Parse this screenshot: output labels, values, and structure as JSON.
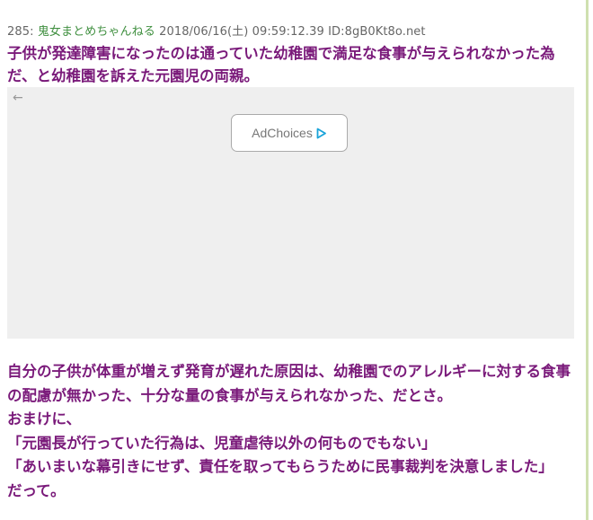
{
  "post": {
    "number": "285:",
    "name": "鬼女まとめちゃんねる",
    "datetime": "2018/06/16(土) 09:59:12.39",
    "id": "ID:8gB0Kt8o.net",
    "title": "子供が発達障害になったのは通っていた幼稚園で満足な食事が与えられなかった為だ、と幼稚園を訴えた元園児の両親。"
  },
  "ad": {
    "back_glyph": "←",
    "adchoices_label": "AdChoices",
    "adchoices_icon": "adchoices-triangle-icon",
    "accent_color": "#1aa3d9"
  },
  "body_lines": [
    "自分の子供が体重が増えず発育が遅れた原因は、幼稚園でのアレルギーに対する食事の配慮が無かった、十分な量の食事が与えられなかった、だとさ。",
    "おまけに、",
    "「元園長が行っていた行為は、児童虐待以外の何ものでもない」",
    "「あいまいな幕引きにせず、責任を取ってもらうために民事裁判を決意しました」",
    "だって。"
  ],
  "colors": {
    "title": "#7a1a7a",
    "name_link": "#3f8f3f",
    "meta_text": "#666666",
    "ad_background": "#efefef"
  }
}
